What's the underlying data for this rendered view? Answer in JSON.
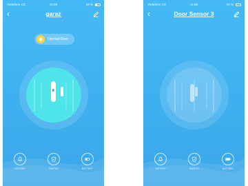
{
  "left_screen": {
    "status_bar": {
      "carrier": "Vodafone CZ",
      "time": "10:46",
      "battery": "34 %"
    },
    "nav": {
      "title": "garaz"
    },
    "alert_badge": {
      "text": "Opened Door"
    },
    "sensor_state": "open",
    "toolbar": [
      {
        "label": "HISTORY",
        "icon": "bell-icon"
      },
      {
        "label": "SWITCH",
        "icon": "shield-icon"
      },
      {
        "label": "BATTERY",
        "icon": "battery-icon"
      }
    ]
  },
  "right_screen": {
    "status_bar": {
      "carrier": "Vodafone CZ",
      "time": "11:56",
      "battery": "26 %"
    },
    "nav": {
      "title": "Door Sensor 3"
    },
    "sensor_state": "closed",
    "toolbar": [
      {
        "label": "HISTORY",
        "icon": "bell-icon"
      },
      {
        "label": "SWITCH",
        "icon": "shield-icon"
      },
      {
        "label": "BATTERY",
        "icon": "battery-icon"
      }
    ]
  },
  "colors": {
    "background": "#45b9f5",
    "active_ring": "#4fe3ea",
    "badge_icon": "#fbd33c",
    "battery_charging": "#4ee06d"
  }
}
